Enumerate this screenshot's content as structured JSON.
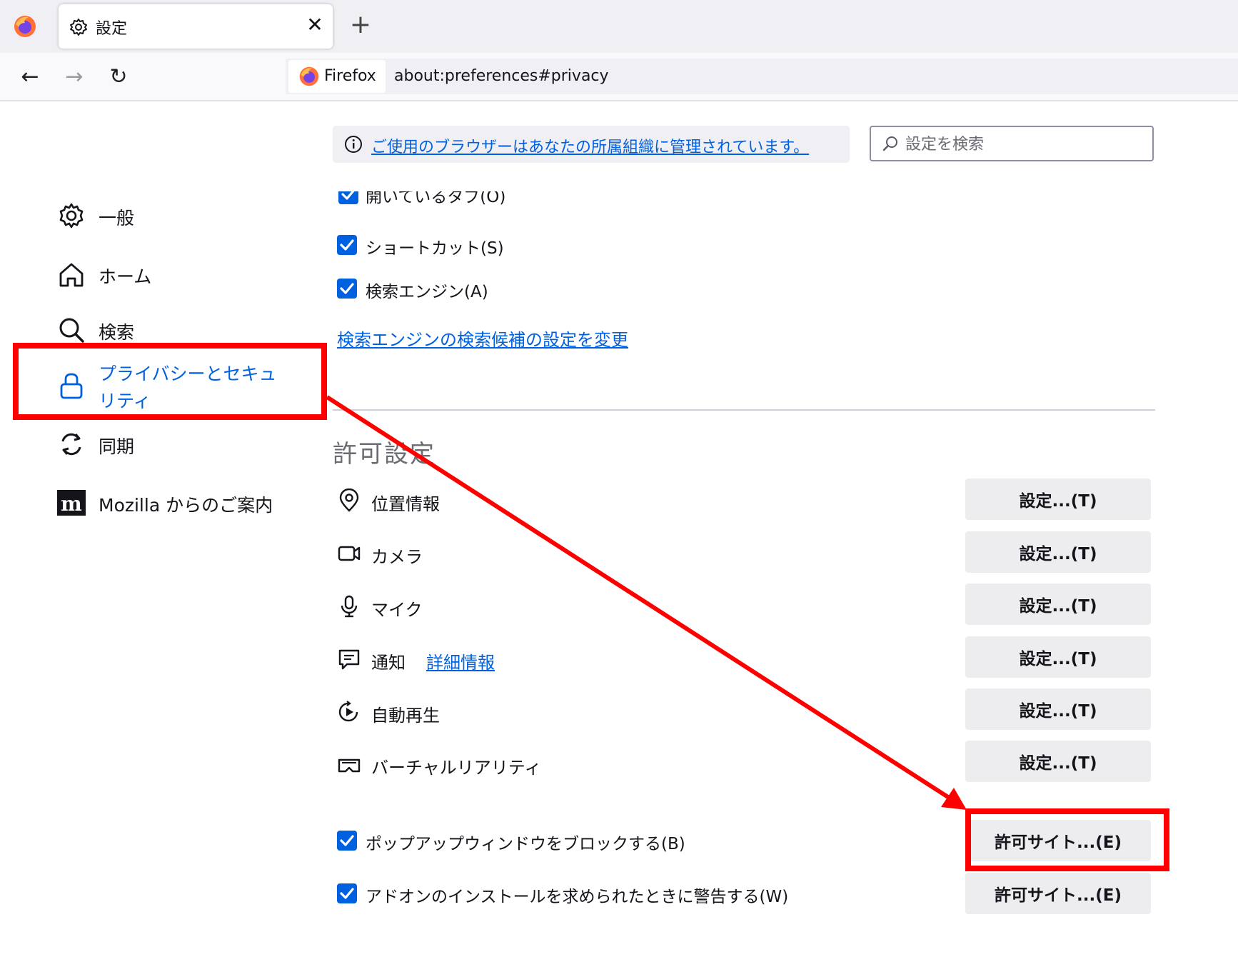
{
  "tab": {
    "title": "設定",
    "close": "✕",
    "new_tab": "+"
  },
  "nav": {
    "back": "←",
    "forward": "→",
    "reload": "↻"
  },
  "urlbar": {
    "identity": "Firefox",
    "url": "about:preferences#privacy"
  },
  "notice": {
    "text": "ご使用のブラウザーはあなたの所属組織に管理されています。"
  },
  "search": {
    "placeholder": "設定を検索"
  },
  "sidebar": {
    "items": [
      {
        "label": "一般",
        "icon": "gear-icon"
      },
      {
        "label": "ホーム",
        "icon": "home-icon"
      },
      {
        "label": "検索",
        "icon": "search-icon"
      },
      {
        "label": "プライバシーとセキュリティ",
        "icon": "lock-icon",
        "selected": true
      },
      {
        "label": "同期",
        "icon": "sync-icon"
      },
      {
        "label": "Mozilla からのご案内",
        "icon": "mozilla-icon"
      }
    ]
  },
  "suggestions": {
    "cut_item": "開いているタブ(O)",
    "shortcut": "ショートカット(S)",
    "engine": "検索エンジン(A)",
    "engine_link": "検索エンジンの検索候補の設定を変更"
  },
  "permissions": {
    "heading": "許可設定",
    "items": [
      {
        "label": "位置情報",
        "button": "設定...(T)",
        "icon": "location-icon"
      },
      {
        "label": "カメラ",
        "button": "設定...(T)",
        "icon": "camera-icon"
      },
      {
        "label": "マイク",
        "button": "設定...(T)",
        "icon": "microphone-icon"
      },
      {
        "label": "通知",
        "link": "詳細情報",
        "button": "設定...(T)",
        "icon": "notification-icon"
      },
      {
        "label": "自動再生",
        "button": "設定...(T)",
        "icon": "autoplay-icon"
      },
      {
        "label": "バーチャルリアリティ",
        "button": "設定...(T)",
        "icon": "vr-icon"
      }
    ],
    "popup": {
      "label": "ポップアップウィンドウをブロックする(B)",
      "button": "許可サイト...(E)"
    },
    "addon": {
      "label": "アドオンのインストールを求められたときに警告する(W)",
      "button": "許可サイト...(E)"
    }
  },
  "colors": {
    "accent": "#0061e0",
    "annotation": "#ff0000",
    "button_bg": "#ededf0"
  }
}
